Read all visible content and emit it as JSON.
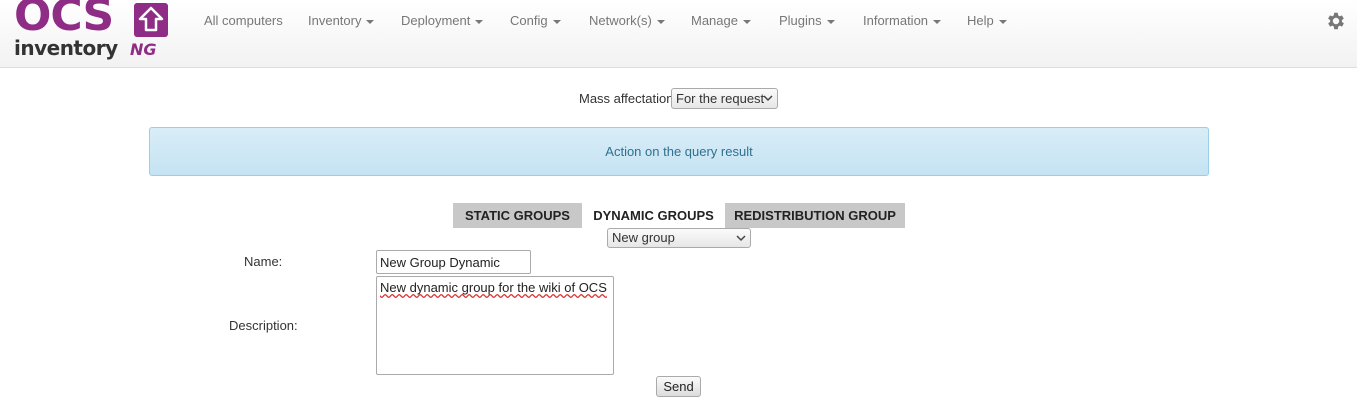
{
  "logo": {
    "top_text": "OCS",
    "bottom_text": "inventory",
    "suffix": "NG"
  },
  "nav": {
    "items": [
      {
        "label": "All computers",
        "dropdown": false
      },
      {
        "label": "Inventory",
        "dropdown": true
      },
      {
        "label": "Deployment",
        "dropdown": true
      },
      {
        "label": "Config",
        "dropdown": true
      },
      {
        "label": "Network(s)",
        "dropdown": true
      },
      {
        "label": "Manage",
        "dropdown": true
      },
      {
        "label": "Plugins",
        "dropdown": true
      },
      {
        "label": "Information",
        "dropdown": true
      },
      {
        "label": "Help",
        "dropdown": true
      }
    ],
    "settings_icon": "gear-icon"
  },
  "mass": {
    "label": "Mass affectation",
    "selected": "For the request"
  },
  "info": {
    "text": "Action on the query result"
  },
  "tabs": [
    {
      "label": "STATIC GROUPS",
      "active": false
    },
    {
      "label": "DYNAMIC GROUPS",
      "active": true
    },
    {
      "label": "REDISTRIBUTION GROUP",
      "active": false
    }
  ],
  "group_select": {
    "selected": "New group"
  },
  "form": {
    "name_label": "Name:",
    "name_value": "New Group Dynamic",
    "description_label": "Description:",
    "description_value": "New dynamic group for the wiki of OCS",
    "submit_label": "Send"
  },
  "colors": {
    "brand": "#8e2c86",
    "info_bg": "#d9edf7",
    "info_text": "#31708f"
  }
}
